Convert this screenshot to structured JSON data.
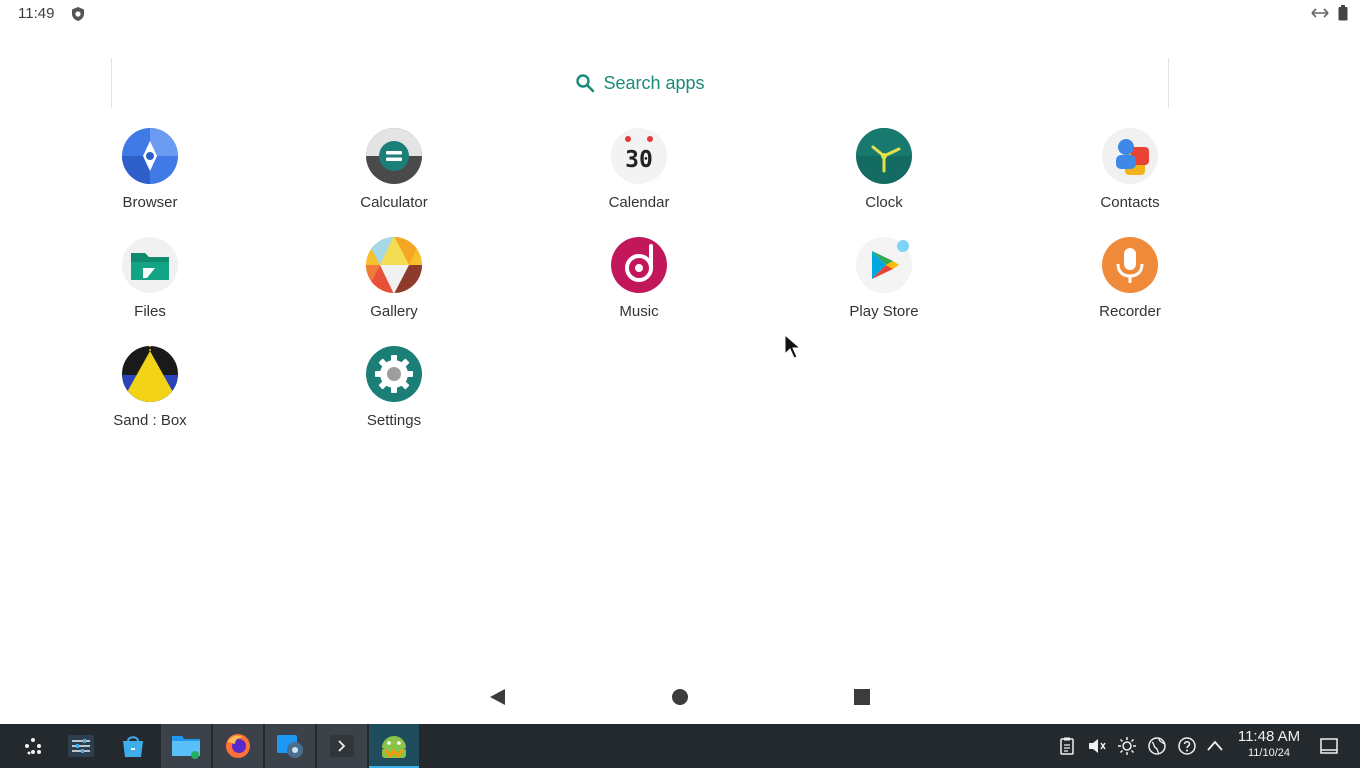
{
  "status_bar": {
    "time": "11:49",
    "icons": [
      "shield-icon",
      "link-icon",
      "battery-icon"
    ]
  },
  "search": {
    "label": "Search apps",
    "icon": "search-icon",
    "accent": "#1a8a7a"
  },
  "apps": [
    {
      "label": "Browser",
      "icon": "browser-icon"
    },
    {
      "label": "Calculator",
      "icon": "calculator-icon"
    },
    {
      "label": "Calendar",
      "icon": "calendar-icon",
      "icon_text": "30"
    },
    {
      "label": "Clock",
      "icon": "clock-icon"
    },
    {
      "label": "Contacts",
      "icon": "contacts-icon"
    },
    {
      "label": "Files",
      "icon": "files-icon"
    },
    {
      "label": "Gallery",
      "icon": "gallery-icon"
    },
    {
      "label": "Music",
      "icon": "music-icon"
    },
    {
      "label": "Play Store",
      "icon": "play-store-icon"
    },
    {
      "label": "Recorder",
      "icon": "recorder-icon"
    },
    {
      "label": "Sand : Box",
      "icon": "sandbox-icon"
    },
    {
      "label": "Settings",
      "icon": "settings-icon"
    }
  ],
  "nav_bar": {
    "buttons": [
      "back-icon",
      "home-icon",
      "recents-icon"
    ]
  },
  "taskbar": {
    "items": [
      "launcher-icon",
      "system-settings-icon",
      "discover-store-icon",
      "file-manager-icon",
      "firefox-icon",
      "system-config-icon",
      "terminal-icon",
      "waydroid-icon"
    ],
    "tray": [
      "clipboard-icon",
      "volume-icon",
      "brightness-icon",
      "network-icon",
      "help-icon",
      "tray-expand-icon"
    ],
    "clock": {
      "time": "11:48 AM",
      "date": "11/10/24"
    },
    "show_desktop": "show-desktop-icon",
    "background": "#24292e",
    "highlight": "#3daee9"
  }
}
